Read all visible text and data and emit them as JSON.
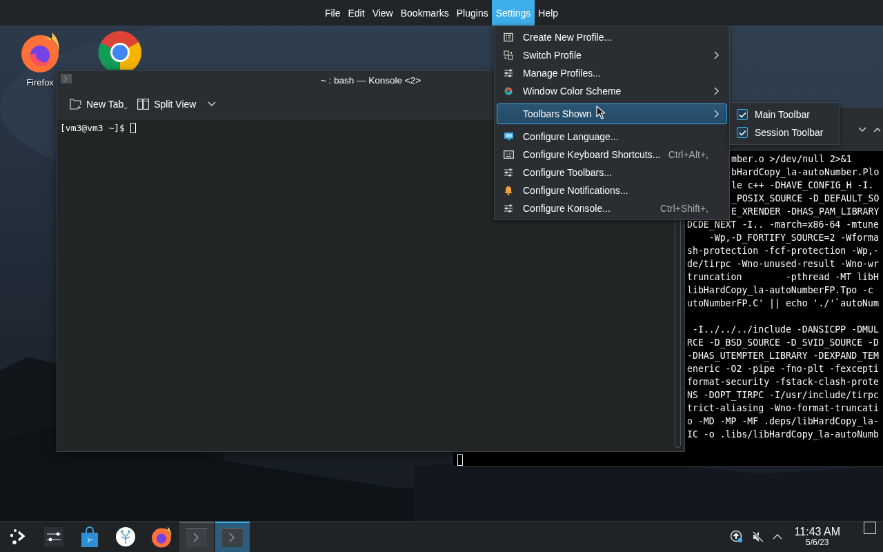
{
  "menubar": [
    {
      "label": "File",
      "selected": false
    },
    {
      "label": "Edit",
      "selected": false
    },
    {
      "label": "View",
      "selected": false
    },
    {
      "label": "Bookmarks",
      "selected": false
    },
    {
      "label": "Plugins",
      "selected": false
    },
    {
      "label": "Settings",
      "selected": true
    },
    {
      "label": "Help",
      "selected": false
    }
  ],
  "desktop_icons": [
    {
      "kind": "labeled",
      "label": "Firefox"
    },
    {
      "kind": "covered"
    }
  ],
  "back_window": {
    "lines_beside_menu": [
      "mber.o >/dev/null 2>&1",
      "bHardCopy_la-autoNumber.Plo",
      "le c++ -DHAVE_CONFIG_H -I.",
      "_POSIX_SOURCE -D_DEFAULT_SO",
      "E_XRENDER -DHAS_PAM_LIBRARY"
    ],
    "lines": [
      "DCDE_NEXT -I.. -march=x86-64 -mtune",
      "    -Wp,-D_FORTIFY_SOURCE=2 -Wforma",
      "sh-protection -fcf-protection -Wp,-",
      "de/tirpc -Wno-unused-result -Wno-wr",
      "truncation        -pthread -MT libH",
      "libHardCopy_la-autoNumberFP.Tpo -c",
      "utoNumberFP.C' || echo './'`autoNum"
    ],
    "lines_lower": [
      " -I../../../include -DANSICPP -DMUL",
      "RCE -D_BSD_SOURCE -D_SVID_SOURCE -D",
      "-DHAS_UTEMPTER_LIBRARY -DEXPAND_TEM",
      "eneric -O2 -pipe -fno-plt -fexcepti",
      "format-security -fstack-clash-prote",
      "NS -DOPT_TIRPC -I/usr/include/tirpc",
      "trict-aliasing -Wno-format-truncati",
      "o -MD -MP -MF .deps/libHardCopy_la-",
      "IC -o .libs/libHardCopy_la-autoNumb"
    ]
  },
  "window": {
    "title": "~ : bash — Konsole <2>",
    "toolbar": [
      {
        "kind": "newtab",
        "label": "New Tab"
      },
      {
        "kind": "split",
        "label": "Split View"
      }
    ],
    "prompt": "[vm3@vm3 ~]$ "
  },
  "menu": {
    "sections": [
      [
        {
          "label": "Create New Profile...",
          "submenu": false,
          "selected": false
        },
        {
          "label": "Switch Profile",
          "submenu": true,
          "selected": false
        },
        {
          "label": "Manage Profiles...",
          "submenu": false,
          "selected": false
        },
        {
          "label": "Window Color Scheme",
          "submenu": true,
          "selected": false
        }
      ],
      [
        {
          "label": "Toolbars Shown",
          "submenu": true,
          "selected": true
        }
      ],
      [
        {
          "label": "Configure Language...",
          "submenu": false,
          "selected": false
        },
        {
          "label": "Configure Keyboard Shortcuts...",
          "shortcut": "Ctrl+Alt+,",
          "submenu": false,
          "selected": false
        },
        {
          "label": "Configure Toolbars...",
          "submenu": false,
          "selected": false
        },
        {
          "label": "Configure Notifications...",
          "submenu": false,
          "selected": false
        },
        {
          "label": "Configure Konsole...",
          "shortcut": "Ctrl+Shift+,",
          "submenu": false,
          "selected": false
        }
      ]
    ]
  },
  "submenu": [
    {
      "label": "Main Toolbar",
      "checked": true
    },
    {
      "label": "Session Toolbar",
      "checked": true
    }
  ],
  "taskbar": {
    "tasks": [
      {
        "selected": false
      },
      {
        "selected": true
      }
    ],
    "clock": {
      "time": "11:43 AM",
      "date": "5/6/23"
    }
  }
}
